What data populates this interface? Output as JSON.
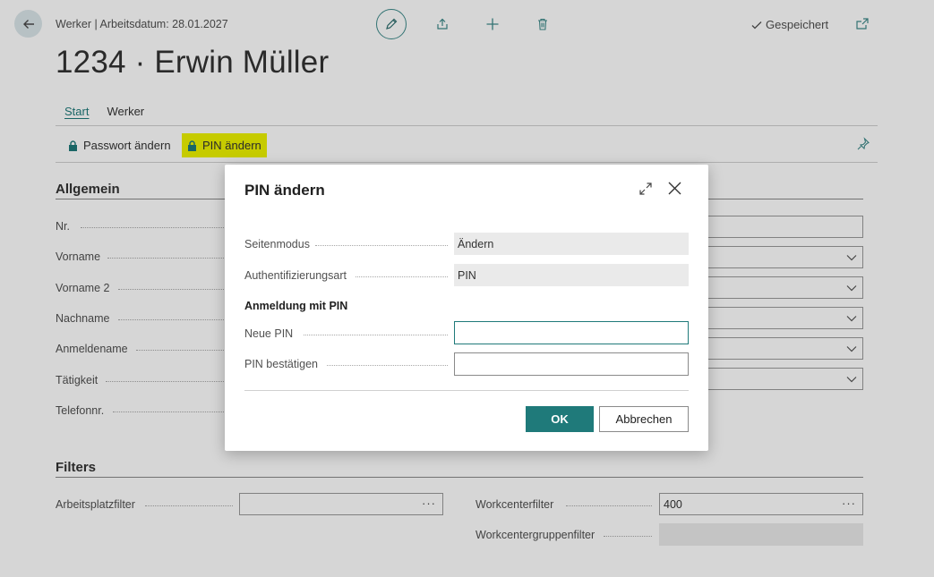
{
  "header": {
    "breadcrumb": "Werker | Arbeitsdatum: 28.01.2027",
    "saved_status": "Gespeichert",
    "title": "1234 · Erwin Müller"
  },
  "tabs": [
    {
      "label": "Start"
    },
    {
      "label": "Werker"
    }
  ],
  "actions": [
    {
      "label": "Passwort ändern",
      "icon": "lock-icon"
    },
    {
      "label": "PIN ändern",
      "icon": "lock-icon",
      "highlighted": true
    }
  ],
  "colors": {
    "accent": "#1f7a7a",
    "highlight": "#ecf200"
  },
  "general": {
    "section_title": "Allgemein",
    "fields": [
      {
        "label": "Nr."
      },
      {
        "label": "Vorname"
      },
      {
        "label": "Vorname 2"
      },
      {
        "label": "Nachname"
      },
      {
        "label": "Anmeldename"
      },
      {
        "label": "Tätigkeit"
      },
      {
        "label": "Telefonnr."
      }
    ]
  },
  "filters": {
    "section_title": "Filters",
    "arbeitsplatz_label": "Arbeitsplatzfilter",
    "arbeitsplatz_value": "",
    "workcenter_label": "Workcenterfilter",
    "workcenter_value": "400",
    "workcentergruppen_label": "Workcentergruppenfilter",
    "workcentergruppen_value": "",
    "ellipsis": "···"
  },
  "dialog": {
    "title": "PIN ändern",
    "seitenmodus_label": "Seitenmodus",
    "seitenmodus_value": "Ändern",
    "auth_label": "Authentifizierungsart",
    "auth_value": "PIN",
    "subheading": "Anmeldung mit PIN",
    "new_pin_label": "Neue PIN",
    "new_pin_value": "",
    "confirm_pin_label": "PIN bestätigen",
    "confirm_pin_value": "",
    "ok_label": "OK",
    "cancel_label": "Abbrechen"
  }
}
